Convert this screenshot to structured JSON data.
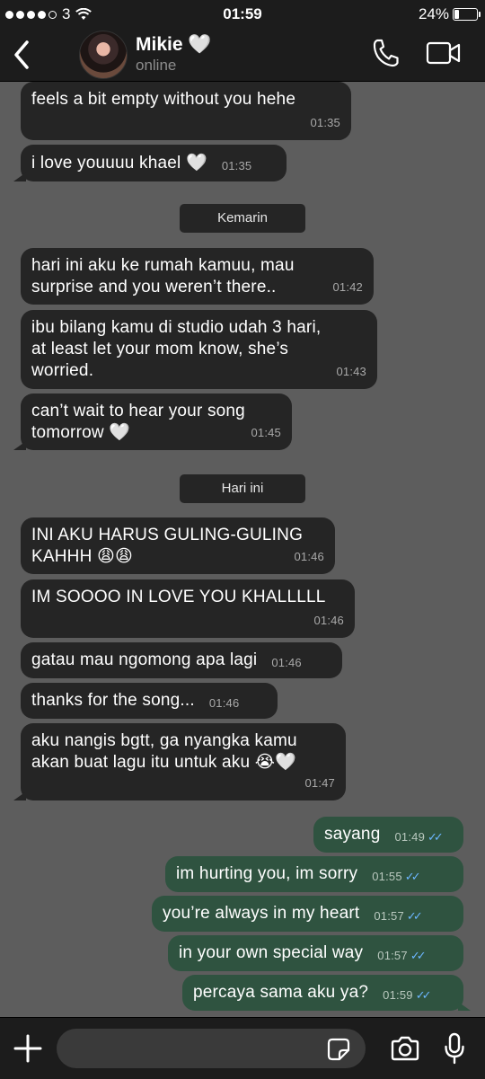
{
  "status_bar": {
    "carrier": "3",
    "time": "01:59",
    "battery": "24%",
    "battery_level": 0.24
  },
  "header": {
    "contact_name": "Mikie 🤍",
    "contact_status": "online"
  },
  "messages": [
    {
      "dir": "in",
      "text": "feels a bit empty without you hehe",
      "time": "01:35"
    },
    {
      "dir": "in",
      "text": "i love youuuu khael 🤍",
      "time": "01:35"
    },
    {
      "dir": "in",
      "text": "hari ini aku ke rumah kamuu, mau surprise and you weren’t there..",
      "time": "01:42"
    },
    {
      "dir": "in",
      "text": "ibu bilang kamu di studio udah 3 hari, at least let your mom know, she’s worried.",
      "time": "01:43"
    },
    {
      "dir": "in",
      "text": "can’t wait to hear your song tomorrow 🤍",
      "time": "01:45"
    },
    {
      "dir": "in",
      "text": "INI AKU HARUS GULING-GULING KAHHH 😩😩",
      "time": "01:46"
    },
    {
      "dir": "in",
      "text": "IM SOOOO IN LOVE YOU KHALLLLL",
      "time": "01:46"
    },
    {
      "dir": "in",
      "text": "gatau mau ngomong apa lagi",
      "time": "01:46"
    },
    {
      "dir": "in",
      "text": "thanks for the song...",
      "time": "01:46"
    },
    {
      "dir": "in",
      "text": "aku nangis bgtt, ga nyangka kamu akan buat lagu itu untuk aku 😭🤍",
      "time": "01:47"
    },
    {
      "dir": "out",
      "text": "sayang",
      "time": "01:49",
      "read": true
    },
    {
      "dir": "out",
      "text": "im hurting you, im sorry",
      "time": "01:55",
      "read": true
    },
    {
      "dir": "out",
      "text": "you’re always in my heart",
      "time": "01:57",
      "read": true
    },
    {
      "dir": "out",
      "text": "in your own special way",
      "time": "01:57",
      "read": true
    },
    {
      "dir": "out",
      "text": "percaya sama aku ya?",
      "time": "01:59",
      "read": true
    }
  ],
  "date_separators": [
    "Kemarin",
    "Hari ini"
  ],
  "message_lines": {
    "m2": [
      "hari ini aku ke rumah kamuu, mau",
      "surprise and you weren’t there.."
    ],
    "m3": [
      "ibu bilang kamu di studio udah 3 hari,",
      "at least let your mom know, she’s",
      "worried."
    ],
    "m4": [
      "can’t wait to hear your song",
      "tomorrow 🤍"
    ],
    "m5": [
      "INI AKU HARUS GULING-GULING",
      "KAHHH 😩😩"
    ],
    "m9": [
      "aku nangis bgtt, ga nyangka kamu",
      "akan buat lagu itu untuk aku 😭🤍"
    ]
  },
  "composer": {
    "placeholder": ""
  },
  "colors": {
    "chat_background": "#5d5d5d",
    "incoming_bubble": "#252525",
    "outgoing_bubble": "#2f5340",
    "read_ticks": "#6cb6ff",
    "bars": "#1c1c1c"
  },
  "icons": [
    "back-icon",
    "phone-icon",
    "video-call-icon",
    "plus-icon",
    "sticker-icon",
    "camera-icon",
    "microphone-icon",
    "wifi-icon",
    "read-ticks-icon"
  ]
}
